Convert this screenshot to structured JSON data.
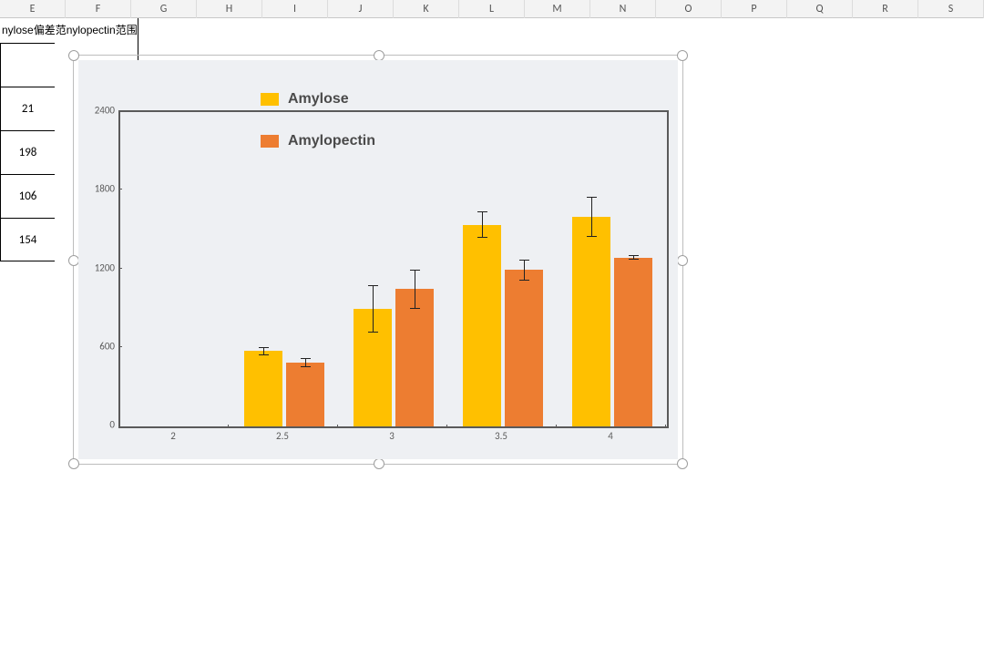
{
  "columns": [
    "E",
    "F",
    "G",
    "H",
    "I",
    "J",
    "K",
    "L",
    "M",
    "N",
    "O",
    "P",
    "Q",
    "R",
    "S"
  ],
  "table": {
    "header": "nylose偏差范nylopectin范围",
    "cells": [
      "",
      "21",
      "198",
      "106",
      "154"
    ]
  },
  "legend": {
    "s1": "Amylose",
    "s2": "Amylopectin"
  },
  "chart_data": {
    "type": "bar",
    "categories": [
      "2",
      "2.5",
      "3",
      "3.5",
      "4"
    ],
    "series": [
      {
        "name": "Amylose",
        "color": "#ffc000",
        "values": [
          null,
          575,
          900,
          1540,
          1600
        ],
        "err": [
          null,
          30,
          180,
          100,
          150
        ]
      },
      {
        "name": "Amylopectin",
        "color": "#ed7d31",
        "values": [
          null,
          490,
          1050,
          1195,
          1290
        ],
        "err": [
          null,
          35,
          150,
          80,
          15
        ]
      }
    ],
    "xlabel": "",
    "ylabel": "",
    "ylim": [
      0,
      2400
    ],
    "yticks": [
      0,
      600,
      1200,
      1800,
      2400
    ]
  }
}
